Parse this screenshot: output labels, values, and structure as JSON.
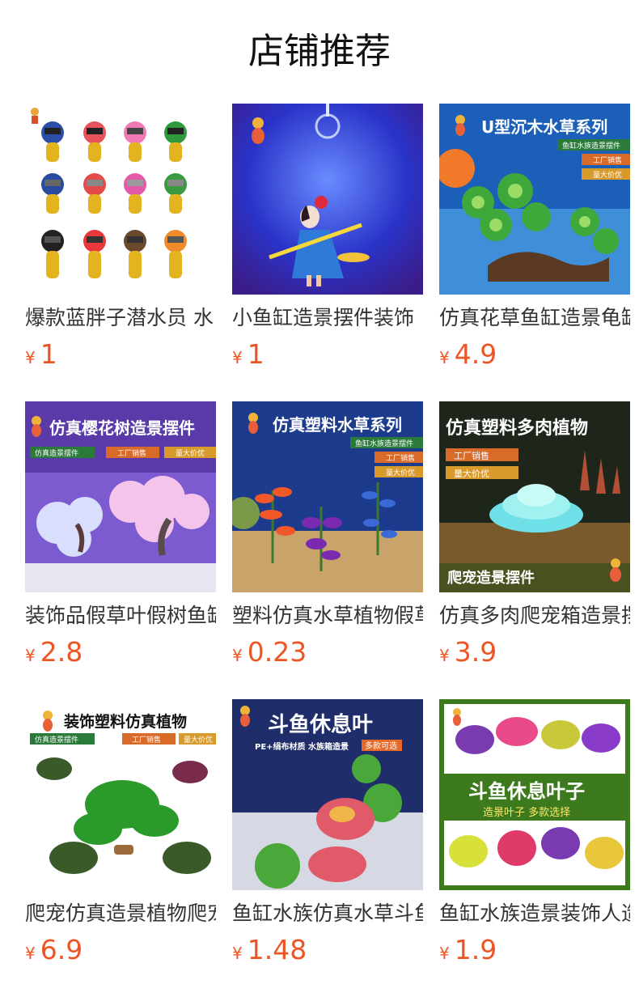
{
  "page": {
    "title": "店铺推荐"
  },
  "products": [
    {
      "name": "爆款蓝胖子潜水员 水",
      "currency": "¥",
      "price": "1",
      "image": {
        "kind": "divers",
        "bg": "#ffffff"
      }
    },
    {
      "name": "小鱼缸造景摆件装饰",
      "currency": "¥",
      "price": "1",
      "image": {
        "kind": "witch",
        "bg": "#2233cc"
      }
    },
    {
      "name": "仿真花草鱼缸造景龟缸",
      "currency": "¥",
      "price": "4.9",
      "image": {
        "kind": "stump",
        "bg": "#1c5fb8",
        "headline": "U型沉木水草系列",
        "tags": [
          "鱼缸水族造景摆件",
          "工厂销售",
          "量大价优"
        ]
      }
    },
    {
      "name": "装饰品假草叶假树鱼缸",
      "currency": "¥",
      "price": "2.8",
      "image": {
        "kind": "sakura",
        "bg": "#6a3fb5",
        "headline": "仿真樱花树造景摆件",
        "tags": [
          "仿真造景摆件",
          "工厂销售",
          "量大价优"
        ]
      }
    },
    {
      "name": "塑料仿真水草植物假草",
      "currency": "¥",
      "price": "0.23",
      "image": {
        "kind": "weeds",
        "bg": "#1d3b8c",
        "headline": "仿真塑料水草系列",
        "tags": [
          "鱼缸水族造景摆件",
          "工厂销售",
          "量大价优"
        ]
      }
    },
    {
      "name": "仿真多肉爬宠箱造景摆",
      "currency": "¥",
      "price": "3.9",
      "image": {
        "kind": "succulent",
        "bg": "#1a2a1a",
        "headline": "仿真塑料多肉植物",
        "tags": [
          "工厂销售",
          "量大价优"
        ],
        "footer": "爬宠造景摆件"
      }
    },
    {
      "name": "爬宠仿真造景植物爬宠",
      "currency": "¥",
      "price": "6.9",
      "image": {
        "kind": "leaves",
        "bg": "#ffffff",
        "headline": "装饰塑料仿真植物",
        "tags": [
          "仿真造景摆件",
          "工厂销售",
          "量大价优"
        ]
      }
    },
    {
      "name": "鱼缸水族仿真水草斗鱼",
      "currency": "¥",
      "price": "1.48",
      "image": {
        "kind": "lilypad",
        "bg": "#1f2d6b",
        "headline": "斗鱼休息叶",
        "tags": [
          "PE+绢布材质 水族箱造景",
          "多款可选"
        ]
      }
    },
    {
      "name": "鱼缸水族造景装饰人造",
      "currency": "¥",
      "price": "1.9",
      "image": {
        "kind": "bettaleaf",
        "bg": "#3d7a1e",
        "headline": "斗鱼休息叶子",
        "tags": [
          "造景叶子 多款选择"
        ]
      }
    }
  ],
  "colors": {
    "price": "#ee5524",
    "text": "#333333"
  }
}
